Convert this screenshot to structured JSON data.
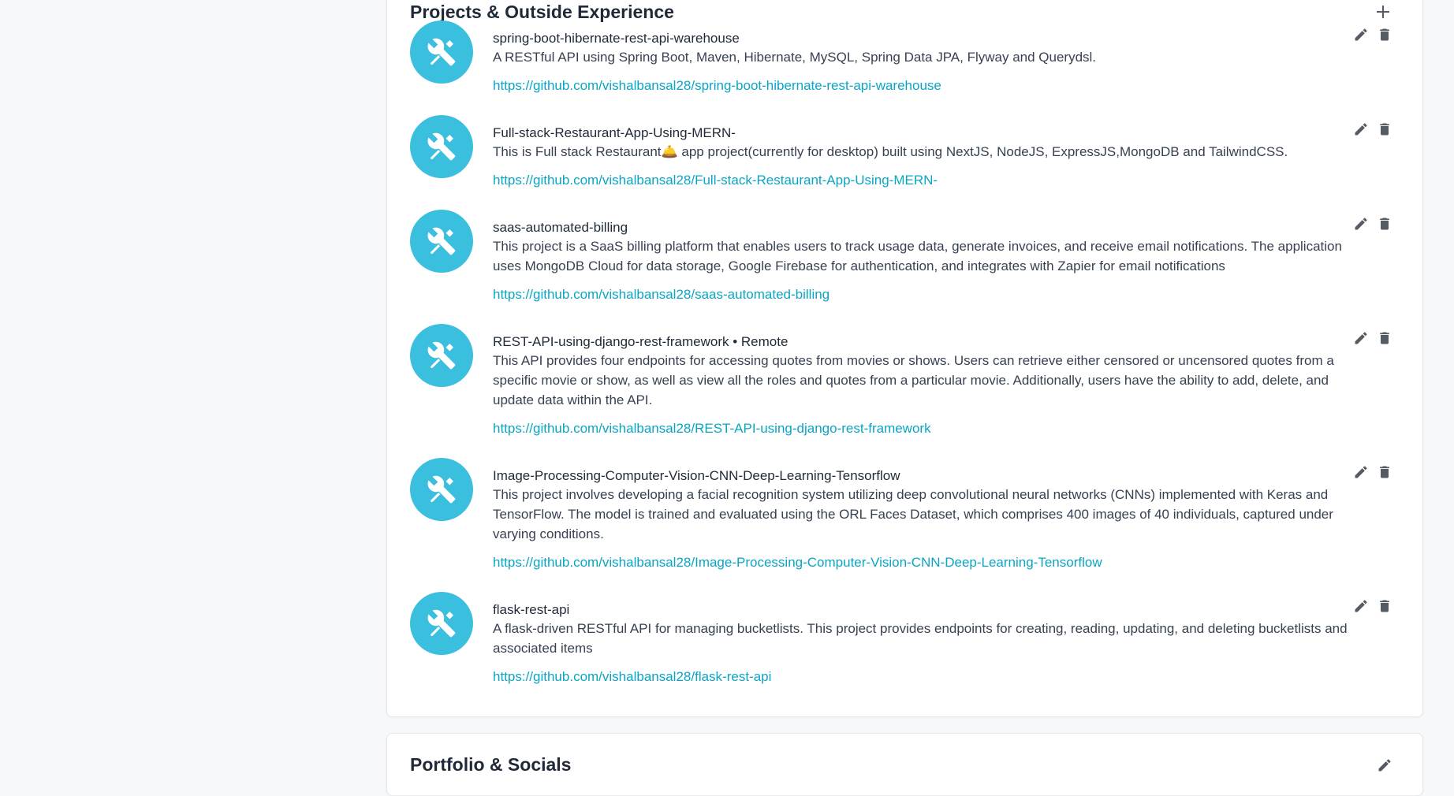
{
  "colors": {
    "accent": "#3bbfde",
    "link": "#0ba5c4",
    "icon": "#555b63"
  },
  "projects_section": {
    "title": "Projects & Outside Experience",
    "add_icon": "plus-icon",
    "items": [
      {
        "icon": "tools-icon",
        "title": "spring-boot-hibernate-rest-api-warehouse",
        "description": "A RESTful API using Spring Boot, Maven, Hibernate, MySQL, Spring Data JPA, Flyway and Querydsl.",
        "link": "https://github.com/vishalbansal28/spring-boot-hibernate-rest-api-warehouse"
      },
      {
        "icon": "tools-icon",
        "title": "Full-stack-Restaurant-App-Using-MERN-",
        "description": "This is Full stack Restaurant🛎️ app project(currently for desktop) built using NextJS, NodeJS, ExpressJS,MongoDB and TailwindCSS.",
        "link": "https://github.com/vishalbansal28/Full-stack-Restaurant-App-Using-MERN-"
      },
      {
        "icon": "tools-icon",
        "title": "saas-automated-billing",
        "description": "This project is a SaaS billing platform that enables users to track usage data, generate invoices, and receive email notifications. The application uses MongoDB Cloud for data storage, Google Firebase for authentication, and integrates with Zapier for email notifications",
        "link": "https://github.com/vishalbansal28/saas-automated-billing"
      },
      {
        "icon": "tools-icon",
        "title": "REST-API-using-django-rest-framework • Remote",
        "description": "This API provides four endpoints for accessing quotes from movies or shows. Users can retrieve either censored or uncensored quotes from a specific movie or show, as well as view all the roles and quotes from a particular movie. Additionally, users have the ability to add, delete, and update data within the API.",
        "link": "https://github.com/vishalbansal28/REST-API-using-django-rest-framework"
      },
      {
        "icon": "tools-icon",
        "title": "Image-Processing-Computer-Vision-CNN-Deep-Learning-Tensorflow",
        "description": "This project involves developing a facial recognition system utilizing deep convolutional neural networks (CNNs) implemented with Keras and TensorFlow. The model is trained and evaluated using the ORL Faces Dataset, which comprises 400 images of 40 individuals, captured under varying conditions.",
        "link": "https://github.com/vishalbansal28/Image-Processing-Computer-Vision-CNN-Deep-Learning-Tensorflow"
      },
      {
        "icon": "tools-icon",
        "title": "flask-rest-api",
        "description": "A flask-driven RESTful API for managing bucketlists. This project provides endpoints for creating, reading, updating, and deleting bucketlists and associated items",
        "link": "https://github.com/vishalbansal28/flask-rest-api"
      }
    ]
  },
  "portfolio_section": {
    "title": "Portfolio & Socials",
    "edit_icon": "pencil-icon"
  }
}
